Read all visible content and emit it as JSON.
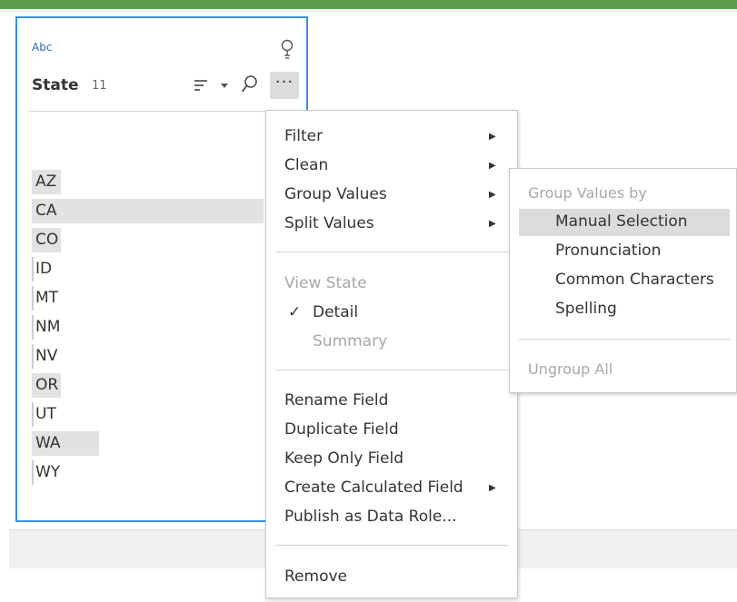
{
  "card": {
    "type_label": "Abc",
    "title": "State",
    "count": "11",
    "icons": {
      "bulb": "lightbulb-icon",
      "sort": "sort-icon",
      "search": "search-icon",
      "more": "more-options-icon"
    },
    "more_label": "···",
    "values": [
      {
        "label": "AZ",
        "fill": 0.11
      },
      {
        "label": "CA",
        "fill": 1.0
      },
      {
        "label": "CO",
        "fill": 0.11
      },
      {
        "label": "ID",
        "fill": 0.0
      },
      {
        "label": "MT",
        "fill": 0.0
      },
      {
        "label": "NM",
        "fill": 0.0
      },
      {
        "label": "NV",
        "fill": 0.0
      },
      {
        "label": "OR",
        "fill": 0.11
      },
      {
        "label": "UT",
        "fill": 0.0
      },
      {
        "label": "WA",
        "fill": 0.29
      },
      {
        "label": "WY",
        "fill": 0.0
      }
    ]
  },
  "context_menu": {
    "filter": "Filter",
    "clean": "Clean",
    "group_values": "Group Values",
    "split_values": "Split Values",
    "view_state_header": "View State",
    "detail": "Detail",
    "check_mark": "✓",
    "summary": "Summary",
    "rename_field": "Rename Field",
    "duplicate_field": "Duplicate Field",
    "keep_only_field": "Keep Only Field",
    "create_calculated_field": "Create Calculated Field",
    "publish_as_data_role": "Publish as Data Role...",
    "remove": "Remove",
    "submenu_arrow": "▶"
  },
  "group_submenu": {
    "header": "Group Values by",
    "manual_selection": "Manual Selection",
    "pronunciation": "Pronunciation",
    "common_characters": "Common Characters",
    "spelling": "Spelling",
    "ungroup_all": "Ungroup All"
  },
  "colors": {
    "accent_green": "#5e9d4c",
    "card_border": "#3a8ee2",
    "highlight_gray": "#dcdcdc"
  }
}
